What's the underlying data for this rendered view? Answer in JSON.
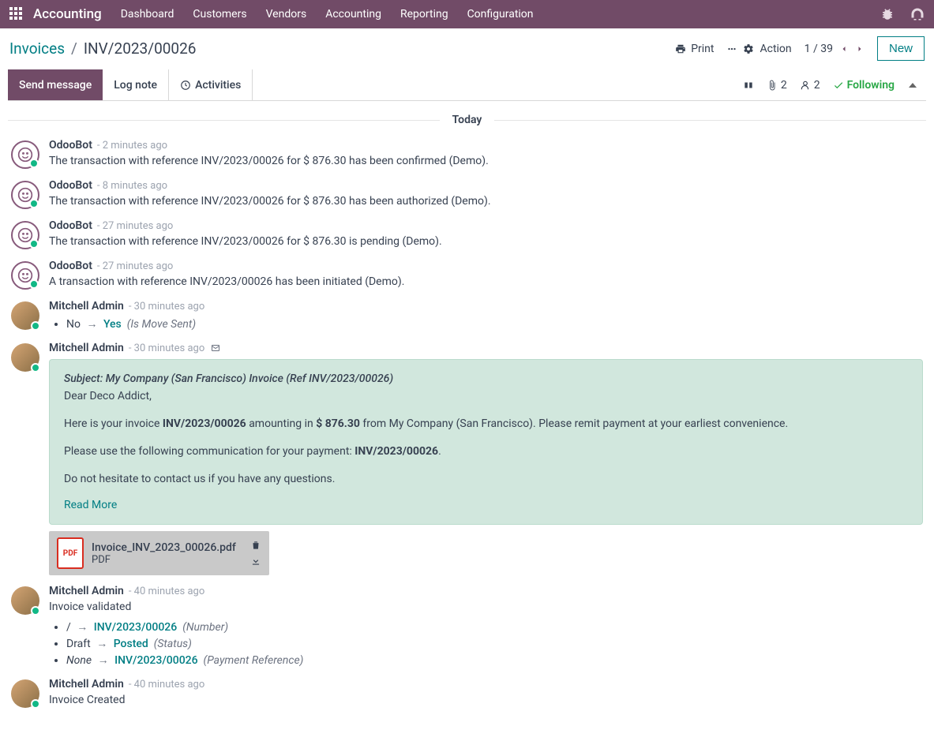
{
  "topbar": {
    "brand": "Accounting",
    "nav": [
      "Dashboard",
      "Customers",
      "Vendors",
      "Accounting",
      "Reporting",
      "Configuration"
    ]
  },
  "breadcrumb": {
    "root": "Invoices",
    "current": "INV/2023/00026"
  },
  "actions": {
    "print": "Print",
    "action": "Action",
    "pager": "1 / 39",
    "new": "New"
  },
  "msgbar": {
    "send": "Send message",
    "log": "Log note",
    "activities": "Activities",
    "attach_count": "2",
    "follow_count": "2",
    "following": "Following"
  },
  "feed": {
    "today": "Today",
    "messages": [
      {
        "author": "OdooBot",
        "time": "- 2 minutes ago",
        "avatar": "bot",
        "text": "The transaction with reference INV/2023/00026 for $ 876.30 has been confirmed (Demo)."
      },
      {
        "author": "OdooBot",
        "time": "- 8 minutes ago",
        "avatar": "bot",
        "text": "The transaction with reference INV/2023/00026 for $ 876.30 has been authorized (Demo)."
      },
      {
        "author": "OdooBot",
        "time": "- 27 minutes ago",
        "avatar": "bot",
        "text": "The transaction with reference INV/2023/00026 for $ 876.30 is pending (Demo)."
      },
      {
        "author": "OdooBot",
        "time": "- 27 minutes ago",
        "avatar": "bot",
        "text": "A transaction with reference INV/2023/00026 has been initiated (Demo)."
      }
    ],
    "change1": {
      "author": "Mitchell Admin",
      "time": "- 30 minutes ago",
      "old": "No",
      "new": "Yes",
      "field": "(Is Move Sent)"
    },
    "email": {
      "author": "Mitchell Admin",
      "time": "- 30 minutes ago",
      "subject": "Subject: My Company (San Francisco) Invoice (Ref INV/2023/00026)",
      "greeting": "Dear Deco Addict,",
      "line1_pre": "Here is your invoice ",
      "inv": "INV/2023/00026",
      "line1_mid": " amounting in ",
      "amount": "$ 876.30",
      "line1_post": " from My Company (San Francisco). Please remit payment at your earliest convenience.",
      "line2_pre": "Please use the following communication for your payment: ",
      "line2_ref": "INV/2023/00026",
      "line2_post": ".",
      "line3": "Do not hesitate to contact us if you have any questions.",
      "readmore": "Read More",
      "attach_name": "Invoice_INV_2023_00026.pdf",
      "attach_type": "PDF"
    },
    "validated": {
      "author": "Mitchell Admin",
      "time": "- 40 minutes ago",
      "title": "Invoice validated",
      "rows": [
        {
          "old": "/",
          "new": "INV/2023/00026",
          "field": "(Number)"
        },
        {
          "old": "Draft",
          "new": "Posted",
          "field": "(Status)"
        },
        {
          "old": "None",
          "new": "INV/2023/00026",
          "field": "(Payment Reference)"
        }
      ]
    },
    "created": {
      "author": "Mitchell Admin",
      "time": "- 40 minutes ago",
      "title": "Invoice Created"
    }
  }
}
